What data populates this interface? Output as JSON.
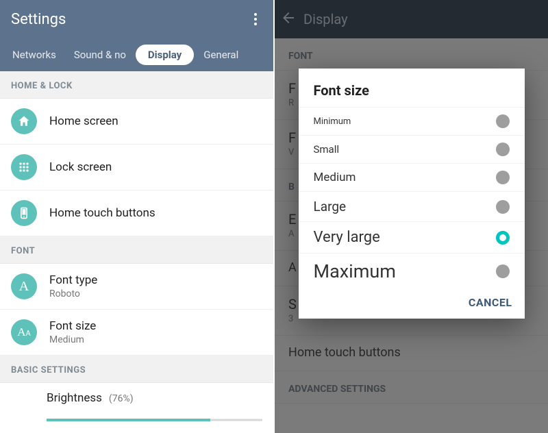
{
  "colors": {
    "accent": "#5ec2bb",
    "header": "#5d738d",
    "dialog_accent": "#00c4c0"
  },
  "left": {
    "title": "Settings",
    "tabs": [
      "Networks",
      "Sound & no",
      "Display",
      "General"
    ],
    "active_tab_index": 2,
    "sections": {
      "home_lock": {
        "header": "HOME & LOCK"
      },
      "font": {
        "header": "FONT"
      },
      "basic": {
        "header": "BASIC SETTINGS"
      }
    },
    "items": {
      "home_screen": {
        "label": "Home screen"
      },
      "lock_screen": {
        "label": "Lock screen"
      },
      "home_touch": {
        "label": "Home touch buttons"
      },
      "font_type": {
        "label": "Font type",
        "value": "Roboto"
      },
      "font_size": {
        "label": "Font size",
        "value": "Medium"
      }
    },
    "brightness": {
      "label": "Brightness",
      "percent_text": "(76%)",
      "percent": 76
    }
  },
  "right": {
    "title": "Display",
    "sections": {
      "font": "FONT",
      "advanced": "ADVANCED SETTINGS"
    },
    "bg_items": {
      "font_type": {
        "primary": "F",
        "secondary": "R"
      },
      "font_size": {
        "primary": "F",
        "secondary": "V"
      },
      "b_section": "B",
      "brightness": {
        "primary": "E",
        "secondary": "A"
      },
      "a_item": {
        "primary": "A"
      },
      "s_item": {
        "primary": "S",
        "secondary": "3"
      },
      "home_touch": "Home touch buttons"
    },
    "dialog": {
      "title": "Font size",
      "options": [
        "Minimum",
        "Small",
        "Medium",
        "Large",
        "Very large",
        "Maximum"
      ],
      "selected_index": 4,
      "cancel": "CANCEL"
    }
  }
}
